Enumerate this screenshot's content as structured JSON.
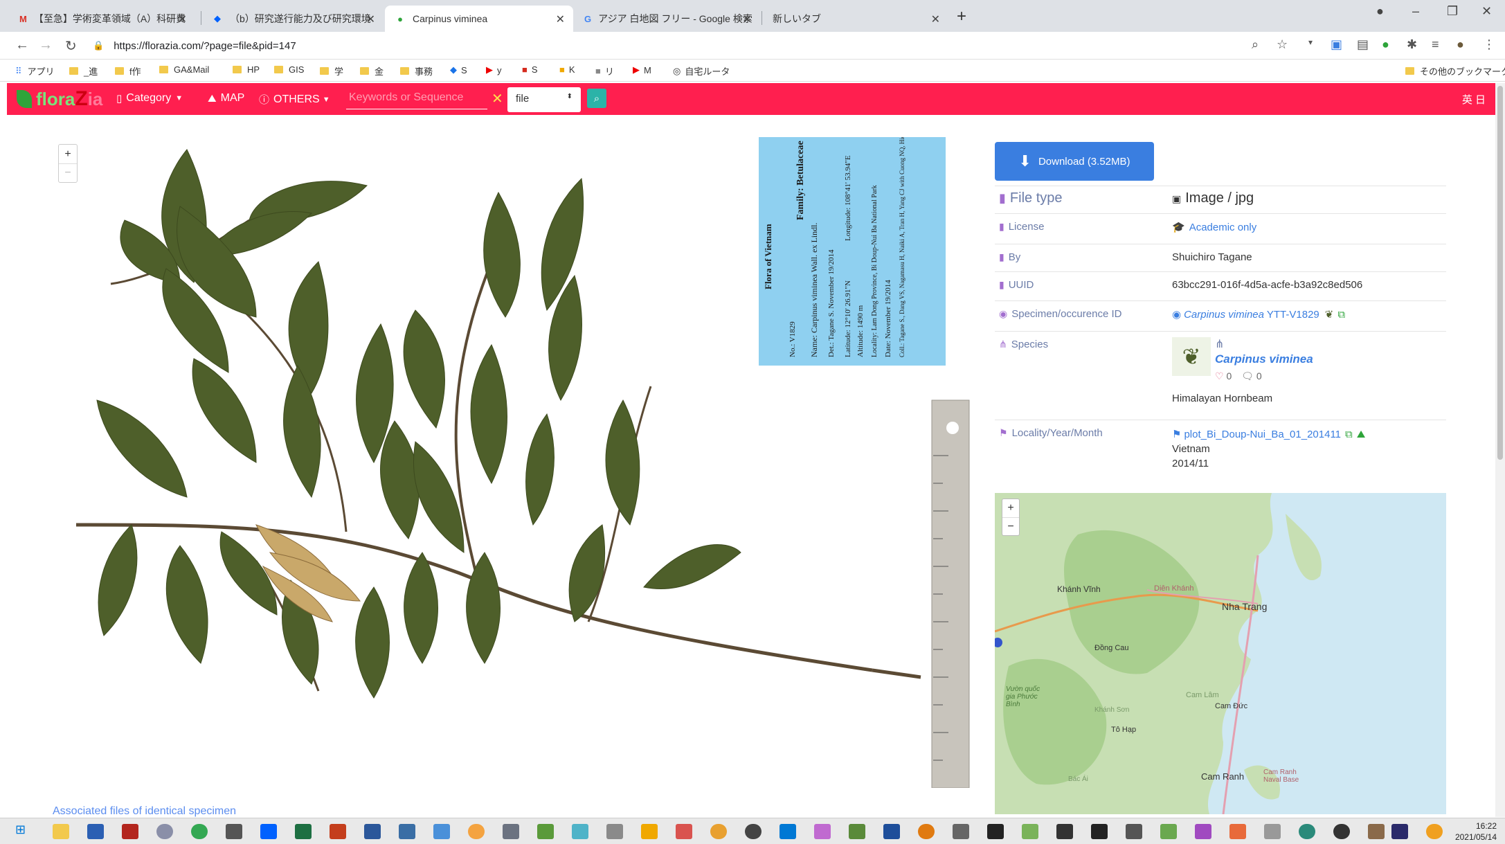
{
  "browser": {
    "tabs": [
      {
        "label": "【至急】学術変革領域（A）科研費"
      },
      {
        "label": "（b）研究遂行能力及び研究環境"
      },
      {
        "label": "Carpinus viminea"
      },
      {
        "label": "アジア 白地図 フリー - Google 検索"
      },
      {
        "label": "新しいタブ"
      }
    ],
    "new_tab": "+",
    "url": "https://florazia.com/?page=file&pid=147",
    "bookmarks": [
      {
        "label": "アプリ",
        "type": "apps"
      },
      {
        "label": "_進",
        "type": "folder"
      },
      {
        "label": "f作",
        "type": "folder"
      },
      {
        "label": "GA&Mail",
        "type": "folder"
      },
      {
        "label": "HP",
        "type": "folder"
      },
      {
        "label": "GIS",
        "type": "folder"
      },
      {
        "label": "学",
        "type": "folder"
      },
      {
        "label": "金",
        "type": "folder"
      },
      {
        "label": "事務",
        "type": "folder"
      },
      {
        "label": "S",
        "type": "site"
      },
      {
        "label": "y",
        "type": "youtube"
      },
      {
        "label": "S",
        "type": "site"
      },
      {
        "label": "K",
        "type": "site"
      },
      {
        "label": "リ",
        "type": "site"
      },
      {
        "label": "M",
        "type": "youtube"
      },
      {
        "label": "自宅ルータ",
        "type": "globe"
      }
    ],
    "other_bookmarks": "その他のブックマーク"
  },
  "nav": {
    "logo_a": "flora",
    "logo_z": "Z",
    "logo_b": "ia",
    "category": "Category",
    "map": "MAP",
    "others": "OTHERS",
    "search_placeholder": "Keywords or Sequence",
    "file_select": "file",
    "lang": "英 日"
  },
  "specimen": {
    "zoom_in": "+",
    "zoom_out": "−",
    "label_title": "Flora of Vietnam",
    "label_family": "Family: Betulaceae",
    "label_name": "Name: Carpinus viminea Wall. ex Lindl.",
    "label_no": "No.: V1829",
    "label_det": "Det.: Tagane S. November 19/2014",
    "label_lat": "Latitude: 12°10' 26.91\"N",
    "label_lon": "Longitude: 108°41' 53.94\"E",
    "label_alt": "Altitude: 1490 m",
    "label_loc": "Locality: Lam Dong Province, Bi Doup-Nui Ba National Park",
    "label_date": "Date: November 19/2014",
    "label_coll": "Coll.: Tagane S., Dang VS, Nagamasu H, Naiki A, Tran H, Yang CJ with Cuong NQ, Hieu HNP, Loi XN",
    "associated": "Associated files of identical specimen"
  },
  "download": {
    "label": "Download (3.52MB)"
  },
  "info": {
    "file_type_label": "File type",
    "file_type_value": "Image / jpg",
    "license_label": "License",
    "license_value": "Academic only",
    "by_label": "By",
    "by_value": "Shuichiro Tagane",
    "uuid_label": "UUID",
    "uuid_value": "63bcc291-016f-4d5a-acfe-b3a92c8ed506",
    "specimen_label": "Specimen/occurence ID",
    "specimen_species": "Carpinus viminea",
    "specimen_id": "YTT-V1829",
    "species_label": "Species",
    "species_name": "Carpinus viminea",
    "likes": "0",
    "comments": "0",
    "common_name": "Himalayan Hornbeam",
    "locality_label": "Locality/Year/Month",
    "locality_plot": "plot_Bi_Doup-Nui_Ba_01_201411",
    "locality_country": "Vietnam",
    "locality_date": "2014/11"
  },
  "map": {
    "zoom_in": "+",
    "zoom_out": "−",
    "cities": [
      "Khánh Vĩnh",
      "Diên Khánh",
      "Nha Trang",
      "Đồng Cau",
      "Cam Lâm",
      "Cam Đức",
      "Tô Hạp",
      "Bác Ái",
      "Cam Ranh",
      "Cam Ranh Naval Base",
      "Vườn quốc gia Phước Bình",
      "Khánh Sơn"
    ]
  },
  "taskbar": {
    "time": "16:22",
    "date": "2021/05/14"
  }
}
